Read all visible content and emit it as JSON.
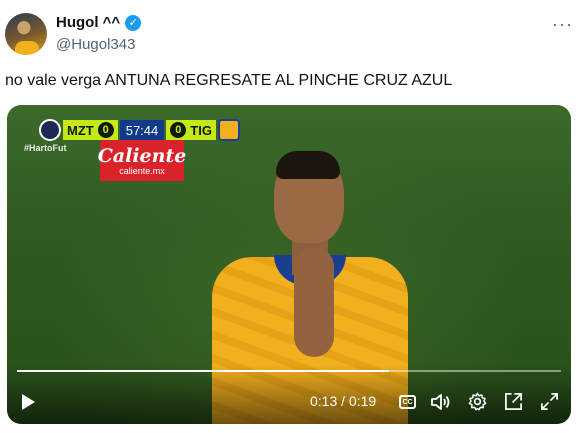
{
  "tweet": {
    "display_name": "Hugol ^^",
    "handle": "@Hugol343",
    "text": "no vale verga ANTUNA REGRESATE AL PINCHE CRUZ AZUL"
  },
  "icons": {
    "verified": "verified-badge-icon",
    "more": "more-options-icon"
  },
  "video": {
    "scorebug": {
      "home": "MZT",
      "home_score": "0",
      "clock": "57:44",
      "away_score": "0",
      "away": "TIG"
    },
    "hashtag": "#HartoFut",
    "sponsor": {
      "name": "Caliente",
      "url": "caliente.mx"
    },
    "time_display": "0:13 / 0:19",
    "progress": 0.684,
    "cc_label": "CC"
  },
  "colors": {
    "accent": "#1d9bf0",
    "scorebug": "#c7e817",
    "sponsor": "#d9222a"
  }
}
